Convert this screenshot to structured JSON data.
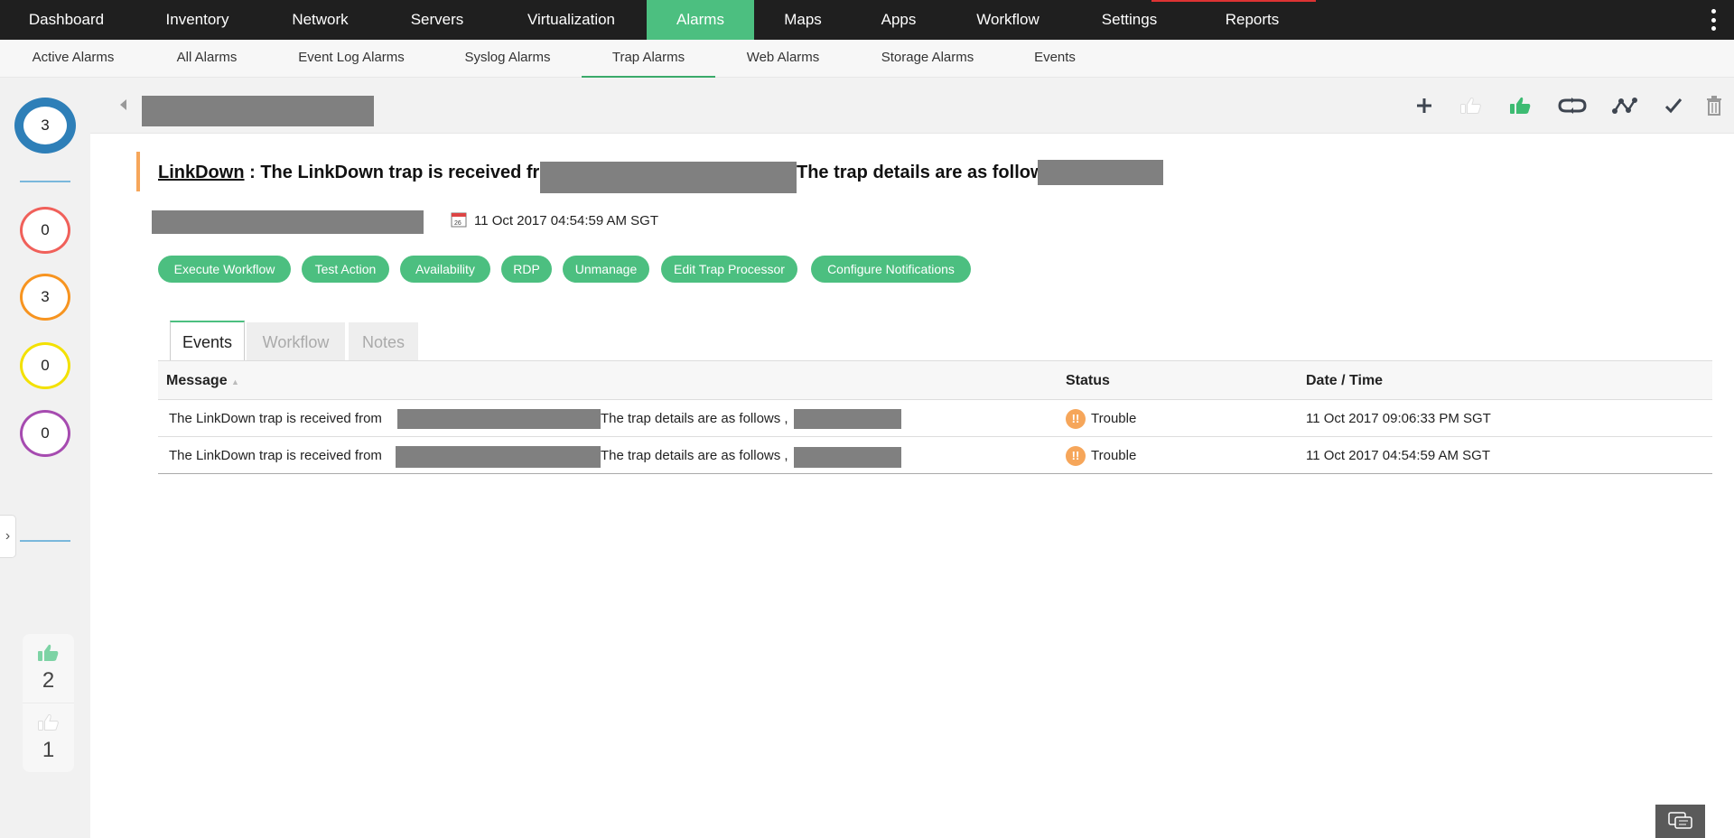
{
  "top_nav": [
    {
      "label": "Dashboard"
    },
    {
      "label": "Inventory"
    },
    {
      "label": "Network"
    },
    {
      "label": "Servers"
    },
    {
      "label": "Virtualization"
    },
    {
      "label": "Alarms",
      "active": true
    },
    {
      "label": "Maps"
    },
    {
      "label": "Apps"
    },
    {
      "label": "Workflow"
    },
    {
      "label": "Settings"
    },
    {
      "label": "Reports"
    }
  ],
  "sub_nav": [
    {
      "label": "Active Alarms"
    },
    {
      "label": "All Alarms"
    },
    {
      "label": "Event Log Alarms"
    },
    {
      "label": "Syslog Alarms"
    },
    {
      "label": "Trap Alarms",
      "active": true
    },
    {
      "label": "Web Alarms"
    },
    {
      "label": "Storage Alarms"
    },
    {
      "label": "Events"
    }
  ],
  "sidebar": {
    "total": "3",
    "critical": "0",
    "trouble": "3",
    "attention": "0",
    "service_down": "0",
    "likes": "2",
    "dislikes": "1",
    "colors": {
      "total": "#2e7fb8",
      "critical": "#f0605a",
      "trouble": "#f79420",
      "attention": "#f3e100",
      "service_down": "#a64bb0"
    }
  },
  "toolbar": [
    "add-icon",
    "thumbs-up-outline-icon",
    "thumbs-up-filled-icon",
    "repeat-icon",
    "graph-icon",
    "check-icon",
    "trash-icon"
  ],
  "alarm": {
    "name": "LinkDown",
    "separator": " : ",
    "message_prefix": "The LinkDown trap is received from",
    "message_suffix": "The trap details are as follows ,",
    "date": "11 Oct 2017 04:54:59 AM SGT"
  },
  "actions": [
    "Execute Workflow",
    "Test Action",
    "Availability",
    "RDP",
    "Unmanage",
    "Edit Trap Processor",
    "Configure Notifications"
  ],
  "tabs": [
    "Events",
    "Workflow",
    "Notes"
  ],
  "table": {
    "headers": {
      "message": "Message",
      "status": "Status",
      "datetime": "Date / Time"
    },
    "rows": [
      {
        "prefix": "The LinkDown trap is received from",
        "suffix": "The trap details are as follows ,",
        "status": "Trouble",
        "datetime": "11 Oct 2017 09:06:33 PM SGT"
      },
      {
        "prefix": "The LinkDown trap is received from",
        "suffix": "The trap details are as follows ,",
        "status": "Trouble",
        "datetime": "11 Oct 2017 04:54:59 AM SGT"
      }
    ]
  },
  "colors": {
    "accent": "#4cbf80",
    "nav_bg": "#1f1f1f",
    "trouble": "#f6a65a"
  }
}
